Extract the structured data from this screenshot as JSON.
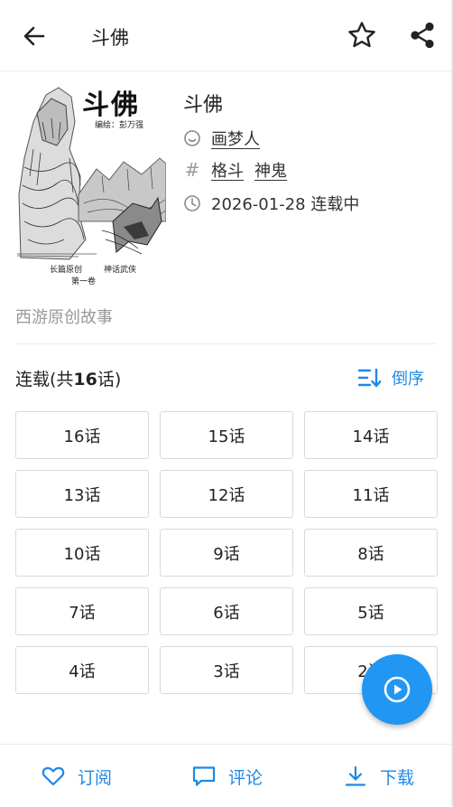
{
  "header": {
    "title": "斗佛",
    "back_icon": "arrow-left-icon",
    "favorite_icon": "star-outline-icon",
    "share_icon": "share-icon"
  },
  "cover": {
    "title_text": "斗佛",
    "author_line": "编绘：彭万强",
    "caption": [
      "长篇原创",
      "神话武侠",
      "第一卷"
    ]
  },
  "info": {
    "title": "斗佛",
    "author": "画梦人",
    "tags": [
      "格斗",
      "神鬼"
    ],
    "update": "2026-01-28 连载中"
  },
  "description": "西游原创故事",
  "chapters_header": {
    "prefix": "连载(共",
    "count": "16",
    "suffix": "话)",
    "sort_label": "倒序"
  },
  "chapters": [
    "16话",
    "15话",
    "14话",
    "13话",
    "12话",
    "11话",
    "10话",
    "9话",
    "8话",
    "7话",
    "6话",
    "5话",
    "4话",
    "3话",
    "2话"
  ],
  "bottom": {
    "subscribe": "订阅",
    "comment": "评论",
    "download": "下载"
  },
  "colors": {
    "accent": "#1e88e5",
    "fab": "#2196f3"
  }
}
